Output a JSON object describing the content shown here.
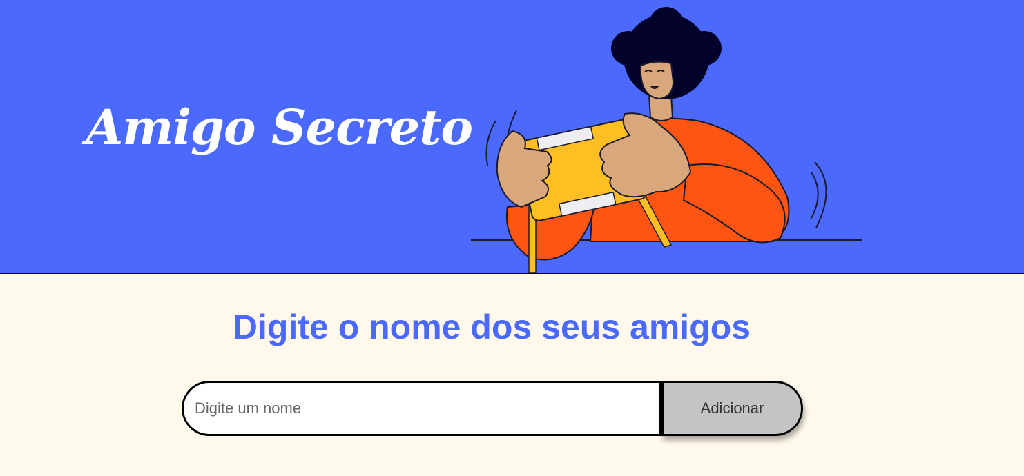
{
  "header": {
    "title": "Amigo Secreto",
    "background_color": "#4B69FD"
  },
  "illustration": {
    "icon": "person-with-gift-illustration"
  },
  "main": {
    "subtitle": "Digite o nome dos seus amigos",
    "background_color": "#FFF9EB",
    "accent_color": "#4B69FD"
  },
  "form": {
    "input_placeholder": "Digite um nome",
    "input_value": "",
    "add_button_label": "Adicionar",
    "button_color": "#C4C4C4"
  }
}
